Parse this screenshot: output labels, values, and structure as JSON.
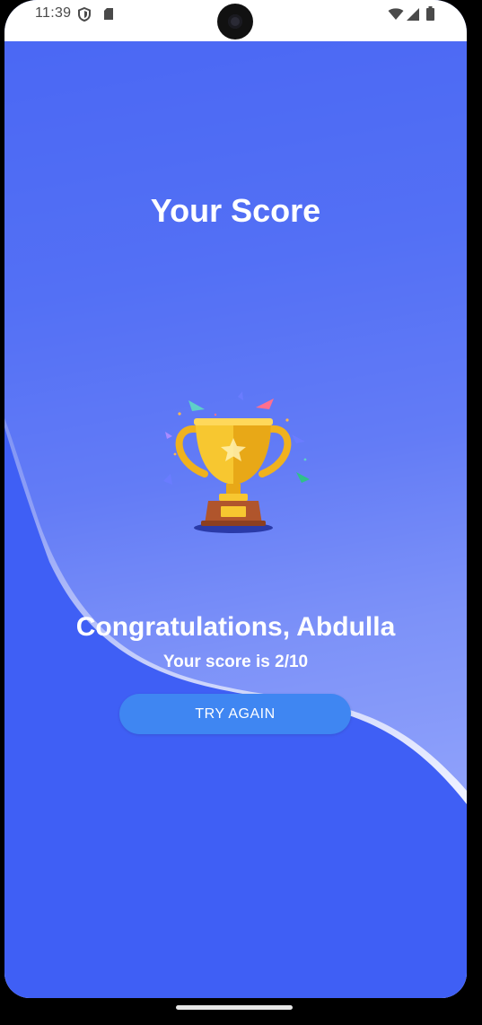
{
  "status_bar": {
    "time": "11:39",
    "icons": [
      "shield-icon",
      "sd-card-icon",
      "wifi-icon",
      "signal-icon",
      "battery-icon"
    ]
  },
  "page": {
    "title": "Your Score",
    "congrats_text": "Congratulations, Abdulla",
    "score_text": "Your score is 2/10",
    "button_label": "TRY AGAIN",
    "image": "trophy-icon"
  },
  "colors": {
    "primary_blue": "#3f5ff5",
    "button_blue": "#3f86f2",
    "text_white": "#ffffff",
    "trophy_gold": "#f5c52a",
    "trophy_base": "#b0552c"
  }
}
